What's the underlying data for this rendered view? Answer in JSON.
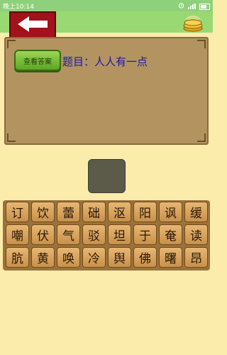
{
  "status": {
    "time": "晚上10:14"
  },
  "header": {
    "back_icon": "arrow-left-icon",
    "coins_icon": "coins-icon"
  },
  "panel": {
    "show_answer_label": "查看答案",
    "question": "题目：人人有一点"
  },
  "answer": {
    "slots": [
      ""
    ]
  },
  "tiles": [
    "订",
    "饮",
    "蕾",
    "础",
    "沤",
    "阳",
    "讽",
    "缓",
    "嘲",
    "伏",
    "气",
    "驳",
    "坦",
    "于",
    "奄",
    "读",
    "肮",
    "黄",
    "唤",
    "冷",
    "舆",
    "佛",
    "曙",
    "昂"
  ],
  "colors": {
    "topbar": "#99d873",
    "back": "#a3111b",
    "question": "#1a1aa8",
    "background": "#fcecac"
  }
}
